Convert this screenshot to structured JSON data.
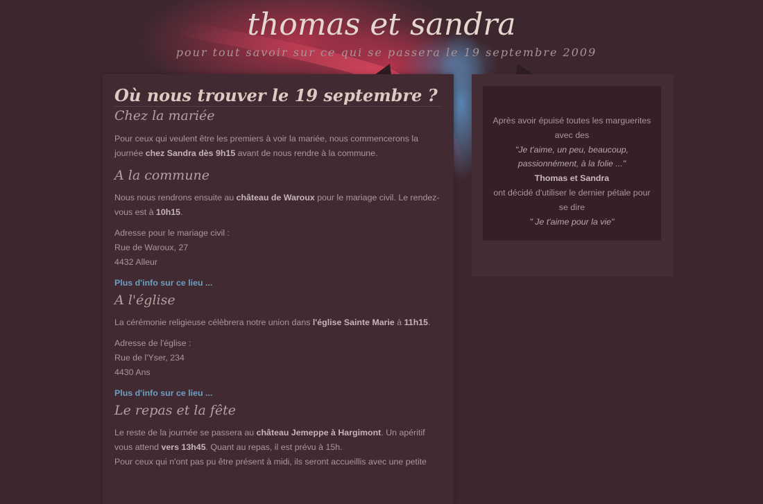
{
  "header": {
    "title": "thomas et sandra",
    "tagline": "pour tout savoir sur ce qui se passera le 19 septembre 2009"
  },
  "main": {
    "heading": "Où nous trouver le 19 septembre ?",
    "sections": [
      {
        "title": "Chez la mariée",
        "p1_a": "Pour ceux qui veulent être les premiers à voir la mariée, nous commencerons la journée ",
        "p1_b": "chez Sandra dès 9h15",
        "p1_c": " avant de nous rendre à la commune."
      },
      {
        "title": "A la commune",
        "p1_a": "Nous nous rendrons ensuite au ",
        "p1_b": "château de Waroux",
        "p1_c": " pour le mariage civil. Le rendez-vous est à ",
        "p1_d": "10h15",
        "p1_e": ".",
        "address": [
          "Adresse pour le mariage civil :",
          "Rue de Waroux, 27",
          "4432 Alleur"
        ],
        "link": "Plus d'info sur ce lieu ..."
      },
      {
        "title": "A l'église",
        "p1_a": "La cérémonie religieuse célèbrera notre union dans ",
        "p1_b": "l'église Sainte Marie",
        "p1_c": " à ",
        "p1_d": "11h15",
        "p1_e": ".",
        "address": [
          "Adresse de l'église :",
          "Rue de l'Yser, 234",
          "4430 Ans"
        ],
        "link": "Plus d'info sur ce lieu ..."
      },
      {
        "title": "Le repas et la fête",
        "p1_a": "Le reste de la journée se passera au ",
        "p1_b": "château Jemeppe à Hargimont",
        "p1_c": ". Un apéritif vous attend ",
        "p1_d": "vers 13h45",
        "p1_e": ". Quant au repas, il est prévu à 15h.",
        "p2": "Pour ceux qui n'ont pas pu être présent à midi, ils seront accueillis avec une petite"
      }
    ]
  },
  "sidebar": {
    "line1": "Après avoir épuisé toutes les marguerites",
    "line2": "avec des",
    "quote1": "\"Je t'aime, un peu, beaucoup,",
    "quote2": "passionnément, à la folie ...\"",
    "names": "Thomas et Sandra",
    "line3": "ont décidé d'utiliser le dernier pétale pour",
    "line4": "se dire",
    "quote3": "\" Je t'aime pour la vie\""
  },
  "colors": {
    "background": "#3d272f",
    "panel": "#412a32",
    "link": "#6f9fbf",
    "accent_red": "#c0354f",
    "accent_blue": "#5a8fc0"
  }
}
